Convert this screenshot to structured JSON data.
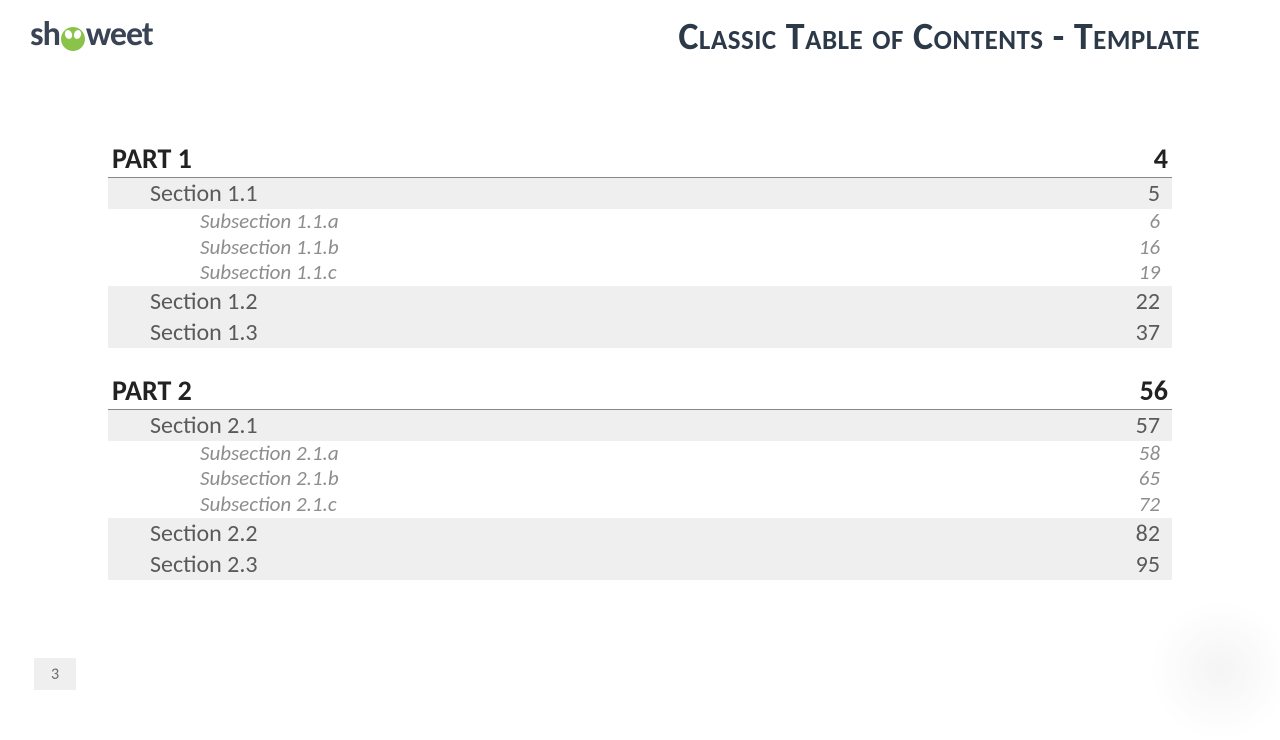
{
  "logo_pre": "sh",
  "logo_post": "weet",
  "title": "Classic Table of Contents - Template",
  "page_number": "3",
  "parts": [
    {
      "label": "PART 1",
      "page": "4",
      "sections": [
        {
          "label": "Section 1.1",
          "page": "5",
          "subs": [
            {
              "label": "Subsection 1.1.a",
              "page": "6"
            },
            {
              "label": "Subsection 1.1.b",
              "page": "16"
            },
            {
              "label": "Subsection 1.1.c",
              "page": "19"
            }
          ]
        },
        {
          "label": "Section 1.2",
          "page": "22",
          "subs": []
        },
        {
          "label": "Section 1.3",
          "page": "37",
          "subs": []
        }
      ]
    },
    {
      "label": "PART 2",
      "page": "56",
      "sections": [
        {
          "label": "Section 2.1",
          "page": "57",
          "subs": [
            {
              "label": "Subsection 2.1.a",
              "page": "58"
            },
            {
              "label": "Subsection 2.1.b",
              "page": "65"
            },
            {
              "label": "Subsection 2.1.c",
              "page": "72"
            }
          ]
        },
        {
          "label": "Section 2.2",
          "page": "82",
          "subs": []
        },
        {
          "label": "Section 2.3",
          "page": "95",
          "subs": []
        }
      ]
    }
  ]
}
